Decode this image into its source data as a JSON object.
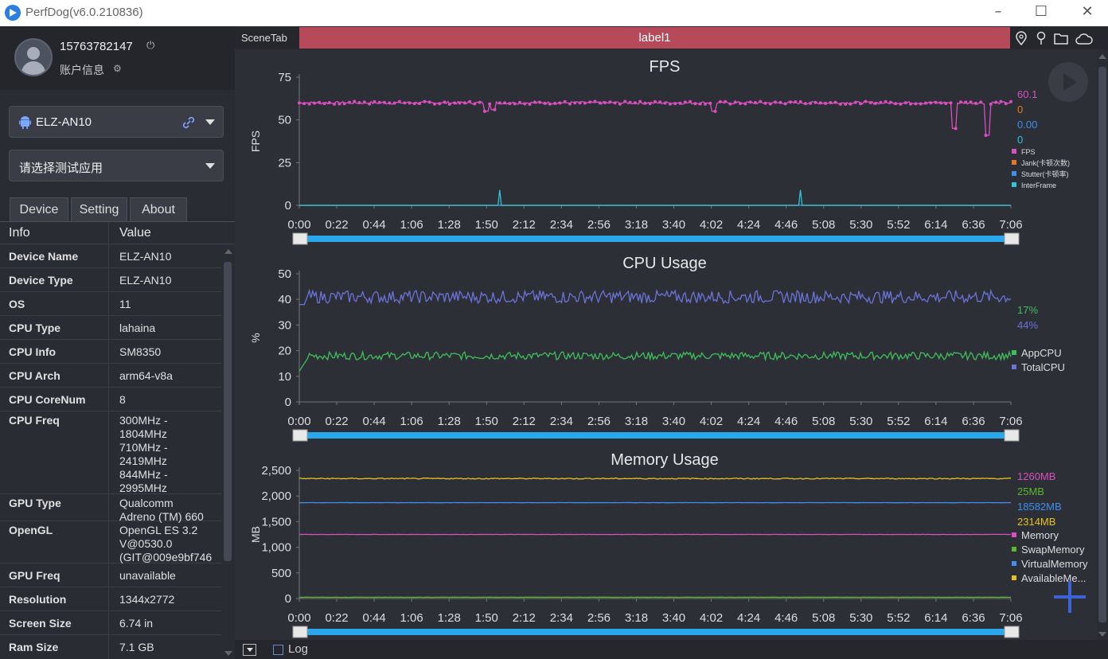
{
  "window": {
    "title": "PerfDog(v6.0.210836)"
  },
  "account": {
    "phone": "15763782147",
    "info_label": "账户信息"
  },
  "device_select": {
    "value": "ELZ-AN10"
  },
  "app_select": {
    "placeholder": "请选择测试应用"
  },
  "tabs": [
    "Device",
    "Setting",
    "About"
  ],
  "info_table": {
    "headers": [
      "Info",
      "Value"
    ],
    "rows": [
      {
        "key": "Device Name",
        "value": "ELZ-AN10"
      },
      {
        "key": "Device Type",
        "value": "ELZ-AN10"
      },
      {
        "key": "OS",
        "value": "11"
      },
      {
        "key": "CPU Type",
        "value": "lahaina"
      },
      {
        "key": "CPU Info",
        "value": "SM8350"
      },
      {
        "key": "CPU Arch",
        "value": "arm64-v8a"
      },
      {
        "key": "CPU CoreNum",
        "value": "8"
      },
      {
        "key": "CPU Freq",
        "value": "300MHz -\n1804MHz\n710MHz -\n2419MHz\n844MHz -\n2995MHz"
      },
      {
        "key": "GPU Type",
        "value": "Qualcomm\nAdreno (TM) 660"
      },
      {
        "key": "OpenGL",
        "value": "OpenGL ES 3.2\nV@0530.0\n(GIT@009e9bf746"
      },
      {
        "key": "GPU Freq",
        "value": "unavailable"
      },
      {
        "key": "Resolution",
        "value": "1344x2772"
      },
      {
        "key": "Screen Size",
        "value": "6.74 in"
      },
      {
        "key": "Ram Size",
        "value": "7.1 GB"
      }
    ]
  },
  "scene": {
    "tab_label": "SceneTab",
    "label": "label1"
  },
  "bottom": {
    "log_label": "Log"
  },
  "icons": {
    "power": "power-icon",
    "account": "user-settings-icon",
    "android": "android-icon",
    "link": "link-icon",
    "location": "location-pin-icon",
    "pin": "pin-icon",
    "folder": "folder-icon",
    "cloud": "cloud-icon",
    "play": "play-icon",
    "plus": "plus-icon"
  },
  "colors": {
    "accent_bar": "#b74a5a",
    "scrollbar": "#2aa8ec"
  },
  "chart_data": [
    {
      "type": "line",
      "title": "FPS",
      "ylabel": "FPS",
      "ylim": [
        0,
        75
      ],
      "yticks": [
        0,
        25,
        50,
        75
      ],
      "xtick_labels": [
        "0:00",
        "0:22",
        "0:44",
        "1:06",
        "1:28",
        "1:50",
        "2:12",
        "2:34",
        "2:56",
        "3:18",
        "3:40",
        "4:02",
        "4:24",
        "4:46",
        "5:08",
        "5:30",
        "5:52",
        "6:14",
        "6:36",
        "7:06"
      ],
      "x_range_seconds": [
        0,
        426
      ],
      "series": [
        {
          "name": "FPS",
          "color": "#d94fc0",
          "current": "60.1",
          "baseline": 60,
          "dips": [
            {
              "t": 112,
              "v": 55
            },
            {
              "t": 116,
              "v": 56
            },
            {
              "t": 248,
              "v": 55
            },
            {
              "t": 392,
              "v": 45
            },
            {
              "t": 412,
              "v": 41
            }
          ]
        },
        {
          "name": "Jank(卡顿次数)",
          "color": "#e8771f",
          "current": "0",
          "baseline": 0,
          "dips": []
        },
        {
          "name": "Stutter(卡顿率)",
          "color": "#3f8ef0",
          "current": "0.00",
          "baseline": 0,
          "dips": []
        },
        {
          "name": "InterFrame",
          "color": "#2fc5d8",
          "current": "0",
          "baseline": 0,
          "spikes": [
            {
              "t": 120,
              "v": 9
            },
            {
              "t": 300,
              "v": 9
            }
          ]
        }
      ],
      "legend_position": "right"
    },
    {
      "type": "line",
      "title": "CPU Usage",
      "ylabel": "%",
      "ylim": [
        0,
        50
      ],
      "yticks": [
        0,
        10,
        20,
        30,
        40,
        50
      ],
      "xtick_labels": [
        "0:00",
        "0:22",
        "0:44",
        "1:06",
        "1:28",
        "1:50",
        "2:12",
        "2:34",
        "2:56",
        "3:18",
        "3:40",
        "4:02",
        "4:24",
        "4:46",
        "5:08",
        "5:30",
        "5:52",
        "6:14",
        "6:36",
        "7:06"
      ],
      "x_range_seconds": [
        0,
        426
      ],
      "series": [
        {
          "name": "AppCPU",
          "color": "#3fbf5a",
          "current": "17%",
          "baseline": 18
        },
        {
          "name": "TotalCPU",
          "color": "#6b73d8",
          "current": "44%",
          "baseline": 41
        }
      ],
      "legend_position": "right"
    },
    {
      "type": "line",
      "title": "Memory Usage",
      "ylabel": "MB",
      "ylim": [
        0,
        2500
      ],
      "yticks": [
        0,
        500,
        1000,
        1500,
        2000,
        2500
      ],
      "ytick_labels": [
        "0",
        "500",
        "1,000",
        "1,500",
        "2,000",
        "2,500"
      ],
      "xtick_labels": [
        "0:00",
        "0:22",
        "0:44",
        "1:06",
        "1:28",
        "1:50",
        "2:12",
        "2:34",
        "2:56",
        "3:18",
        "3:40",
        "4:02",
        "4:24",
        "4:46",
        "5:08",
        "5:30",
        "5:52",
        "6:14",
        "6:36",
        "7:06"
      ],
      "x_range_seconds": [
        0,
        426
      ],
      "series": [
        {
          "name": "Memory",
          "color": "#d94fc0",
          "current": "1260MB",
          "baseline": 1250
        },
        {
          "name": "SwapMemory",
          "color": "#5ab82a",
          "current": "25MB",
          "baseline": 25
        },
        {
          "name": "VirtualMemory",
          "color": "#3f8ef0",
          "current": "18582MB",
          "baseline": 1870
        },
        {
          "name": "AvailableMe...",
          "color": "#e5c020",
          "current": "2314MB",
          "baseline": 2340
        }
      ],
      "legend_position": "right"
    }
  ]
}
